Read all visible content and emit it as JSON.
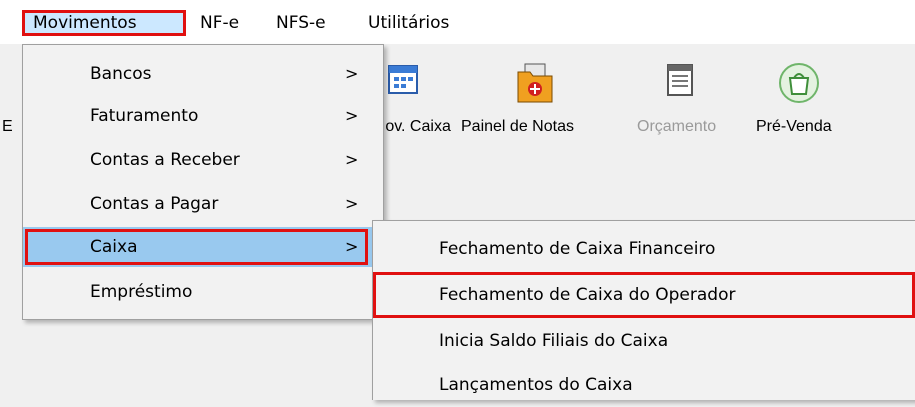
{
  "menubar": {
    "items": [
      "Movimentos",
      "NF-e",
      "NFS-e",
      "Utilitários"
    ]
  },
  "toolbar": {
    "partial_left_label": "E",
    "buttons": [
      {
        "label": "Mov. Caixa",
        "icon": "calendar-icon",
        "enabled": true
      },
      {
        "label": "Painel de Notas",
        "icon": "folder-red-icon",
        "enabled": true
      },
      {
        "label": "Orçamento",
        "icon": "document-icon",
        "enabled": false
      },
      {
        "label": "Pré-Venda",
        "icon": "shopping-bag-icon",
        "enabled": true
      }
    ]
  },
  "dropdown": {
    "items": [
      {
        "label": "Bancos",
        "submenu": true
      },
      {
        "label": "Faturamento",
        "submenu": true
      },
      {
        "label": "Contas a Receber",
        "submenu": true
      },
      {
        "label": "Contas a Pagar",
        "submenu": true
      },
      {
        "label": "Caixa",
        "submenu": true,
        "selected": true
      },
      {
        "label": "Empréstimo",
        "submenu": false
      }
    ],
    "arrow_glyph": ">"
  },
  "submenu": {
    "items": [
      {
        "label": "Fechamento de Caixa Financeiro"
      },
      {
        "label": "Fechamento de Caixa do Operador",
        "highlighted": true
      },
      {
        "label": "Inicia Saldo Filiais do Caixa"
      },
      {
        "label": "Lançamentos do Caixa"
      }
    ]
  },
  "colors": {
    "highlight_border": "#e01010",
    "selected_bg": "#99c9ef",
    "menubar_active_bg": "#cce8ff"
  }
}
